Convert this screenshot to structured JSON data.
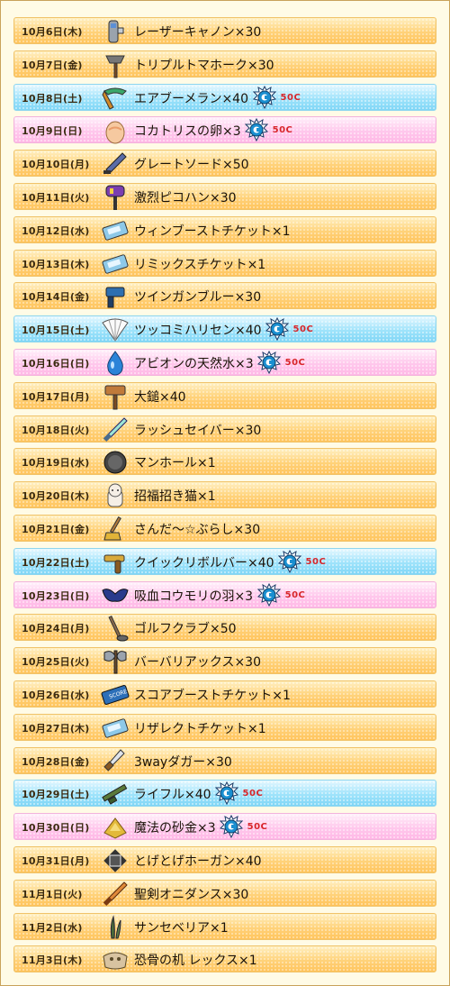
{
  "rows": [
    {
      "date": "10月6日(木)",
      "item": "レーザーキャノン×30",
      "icon": "laser-cannon-icon",
      "type": "normal"
    },
    {
      "date": "10月7日(金)",
      "item": "トリプルトマホーク×30",
      "icon": "tomahawk-icon",
      "type": "normal"
    },
    {
      "date": "10月8日(土)",
      "item": "エアブーメラン×40",
      "icon": "boomerang-icon",
      "type": "sat",
      "price": "50C"
    },
    {
      "date": "10月9日(日)",
      "item": "コカトリスの卵×3",
      "icon": "egg-icon",
      "type": "sun",
      "price": "50C"
    },
    {
      "date": "10月10日(月)",
      "item": "グレートソード×50",
      "icon": "great-sword-icon",
      "type": "normal"
    },
    {
      "date": "10月11日(火)",
      "item": "激烈ピコハン×30",
      "icon": "squeaky-hammer-icon",
      "type": "normal"
    },
    {
      "date": "10月12日(水)",
      "item": "ウィンブーストチケット×1",
      "icon": "ticket-icon",
      "type": "normal"
    },
    {
      "date": "10月13日(木)",
      "item": "リミックスチケット×1",
      "icon": "ticket-icon",
      "type": "normal"
    },
    {
      "date": "10月14日(金)",
      "item": "ツインガンブルー×30",
      "icon": "twin-gun-icon",
      "type": "normal"
    },
    {
      "date": "10月15日(土)",
      "item": "ツッコミハリセン×40",
      "icon": "paper-fan-icon",
      "type": "sat",
      "price": "50C"
    },
    {
      "date": "10月16日(日)",
      "item": "アビオンの天然水×3",
      "icon": "water-drop-icon",
      "type": "sun",
      "price": "50C"
    },
    {
      "date": "10月17日(月)",
      "item": "大鎚×40",
      "icon": "mallet-icon",
      "type": "normal"
    },
    {
      "date": "10月18日(火)",
      "item": "ラッシュセイバー×30",
      "icon": "saber-icon",
      "type": "normal"
    },
    {
      "date": "10月19日(水)",
      "item": "マンホール×1",
      "icon": "manhole-icon",
      "type": "normal"
    },
    {
      "date": "10月20日(木)",
      "item": "招福招き猫×1",
      "icon": "lucky-cat-icon",
      "type": "normal"
    },
    {
      "date": "10月21日(金)",
      "item": "さんだ～☆ぶらし×30",
      "icon": "brush-icon",
      "type": "normal"
    },
    {
      "date": "10月22日(土)",
      "item": "クイックリボルバー×40",
      "icon": "revolver-icon",
      "type": "sat",
      "price": "50C"
    },
    {
      "date": "10月23日(日)",
      "item": "吸血コウモリの羽×3",
      "icon": "bat-wing-icon",
      "type": "sun",
      "price": "50C"
    },
    {
      "date": "10月24日(月)",
      "item": "ゴルフクラブ×50",
      "icon": "golf-club-icon",
      "type": "normal"
    },
    {
      "date": "10月25日(火)",
      "item": "バーバリアックス×30",
      "icon": "axe-icon",
      "type": "normal"
    },
    {
      "date": "10月26日(水)",
      "item": "スコアブーストチケット×1",
      "icon": "score-ticket-icon",
      "type": "normal"
    },
    {
      "date": "10月27日(木)",
      "item": "リザレクトチケット×1",
      "icon": "ticket-icon",
      "type": "normal"
    },
    {
      "date": "10月28日(金)",
      "item": "3wayダガー×30",
      "icon": "dagger-icon",
      "type": "normal"
    },
    {
      "date": "10月29日(土)",
      "item": "ライフル×40",
      "icon": "rifle-icon",
      "type": "sat",
      "price": "50C"
    },
    {
      "date": "10月30日(日)",
      "item": "魔法の砂金×3",
      "icon": "gold-sand-icon",
      "type": "sun",
      "price": "50C"
    },
    {
      "date": "10月31日(月)",
      "item": "とげとげホーガン×40",
      "icon": "spiked-ball-icon",
      "type": "normal"
    },
    {
      "date": "11月1日(火)",
      "item": "聖剣オニダンス×30",
      "icon": "holy-sword-icon",
      "type": "normal"
    },
    {
      "date": "11月2日(水)",
      "item": "サンセベリア×1",
      "icon": "plant-icon",
      "type": "normal"
    },
    {
      "date": "11月3日(木)",
      "item": "恐骨の机 レックス×1",
      "icon": "bone-desk-icon",
      "type": "normal"
    }
  ],
  "colors": {
    "normal": "#ffd27a",
    "saturday": "#9fe3fb",
    "sunday": "#ffc8ec",
    "price": "#d8262a",
    "coin": "#1a8fd0"
  }
}
